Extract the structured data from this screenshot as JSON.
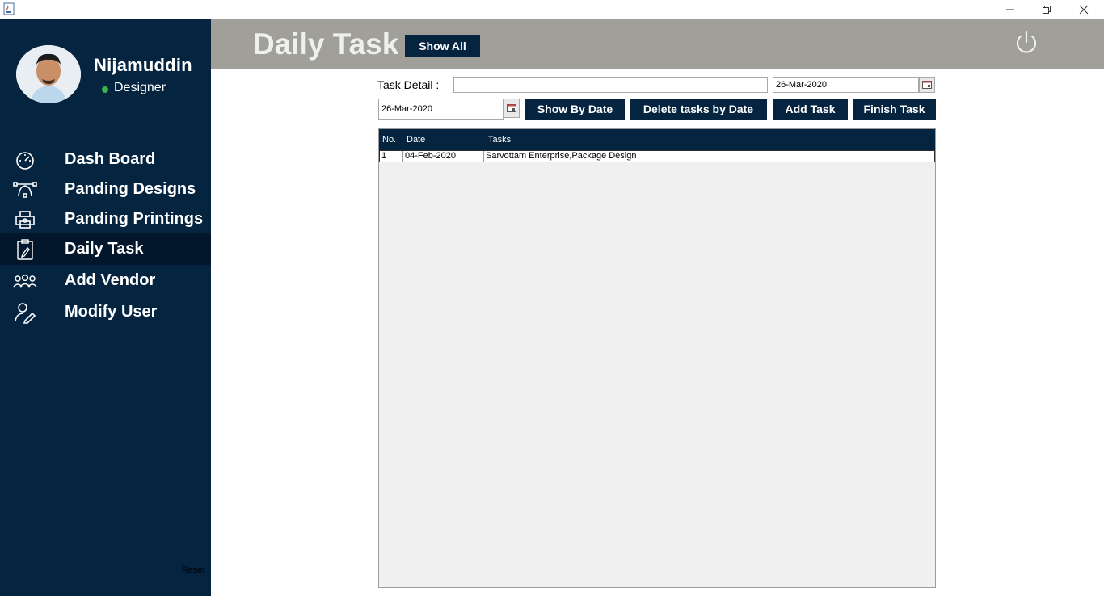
{
  "window": {
    "icons": {
      "app": "java-icon",
      "minimize": "minimize-icon",
      "maximize": "restore-icon",
      "close": "close-icon"
    }
  },
  "user": {
    "name": "Nijamuddin",
    "role": "Designer",
    "status_color": "#39b54a"
  },
  "sidebar": {
    "items": [
      {
        "label": "Dash Board",
        "icon": "speedometer-icon"
      },
      {
        "label": "Panding Designs",
        "icon": "bezier-pen-icon"
      },
      {
        "label": "Panding Printings",
        "icon": "printer-icon"
      },
      {
        "label": "Daily Task",
        "icon": "clipboard-pen-icon",
        "active": true
      },
      {
        "label": "Add Vendor",
        "icon": "people-group-icon"
      },
      {
        "label": "Modify User",
        "icon": "user-edit-icon"
      }
    ],
    "reset_label": "Reset"
  },
  "header": {
    "title": "Daily Task",
    "show_all_label": "Show All",
    "power_icon": "power-icon"
  },
  "form": {
    "task_detail_label": "Task Detail :",
    "task_detail_value": "",
    "task_date_value": "26-Mar-2020",
    "filter_date_value": "26-Mar-2020",
    "calendar_icon": "calendar-icon"
  },
  "actions": {
    "show_by_date": "Show By Date",
    "delete_by_date": "Delete tasks by Date",
    "add_task": "Add Task",
    "finish_task": "Finish Task"
  },
  "table": {
    "columns": [
      "No.",
      "Date",
      "Tasks"
    ],
    "rows": [
      {
        "no": "1",
        "date": "04-Feb-2020",
        "task": "Sarvottam Enterprise,Package Design"
      }
    ]
  },
  "colors": {
    "sidebar_bg": "#052440",
    "header_bg": "#a19f9a",
    "accent": "#052440"
  }
}
